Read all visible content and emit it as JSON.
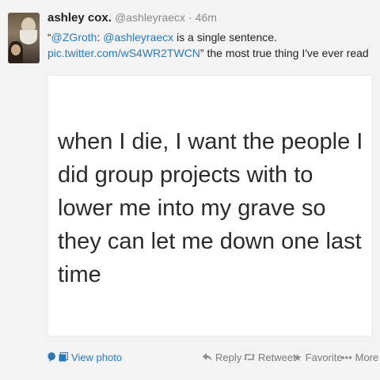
{
  "tweet": {
    "name": "ashley cox.",
    "handle": "@ashleyraecx",
    "time": "· 46m",
    "text": {
      "open_quote": "“",
      "mention1": "@ZGroth",
      "colon": ": ",
      "mention2": "@ashleyraecx",
      "body1": " is a single sentence.",
      "link": "pic.twitter.com/wS4WR2TWCN",
      "body2": "” the most true thing I've ever read"
    },
    "photo_text": "when I die, I want the people I did group projects with to lower me into my grave so they can let me down one last time"
  },
  "actions": {
    "view_photo": "View photo",
    "reply": "Reply",
    "retweet": "Retweet",
    "favorite": "Favorite",
    "more": "More"
  },
  "icons": {
    "conversation": "conversation-icon",
    "photo": "photo-icon",
    "reply": "reply-icon",
    "retweet": "retweet-icon",
    "favorite": "star-icon",
    "more": "ellipsis-icon"
  },
  "colors": {
    "link": "#2a7ab8",
    "muted": "#8a8a8a",
    "background": "#f3f3f3"
  }
}
